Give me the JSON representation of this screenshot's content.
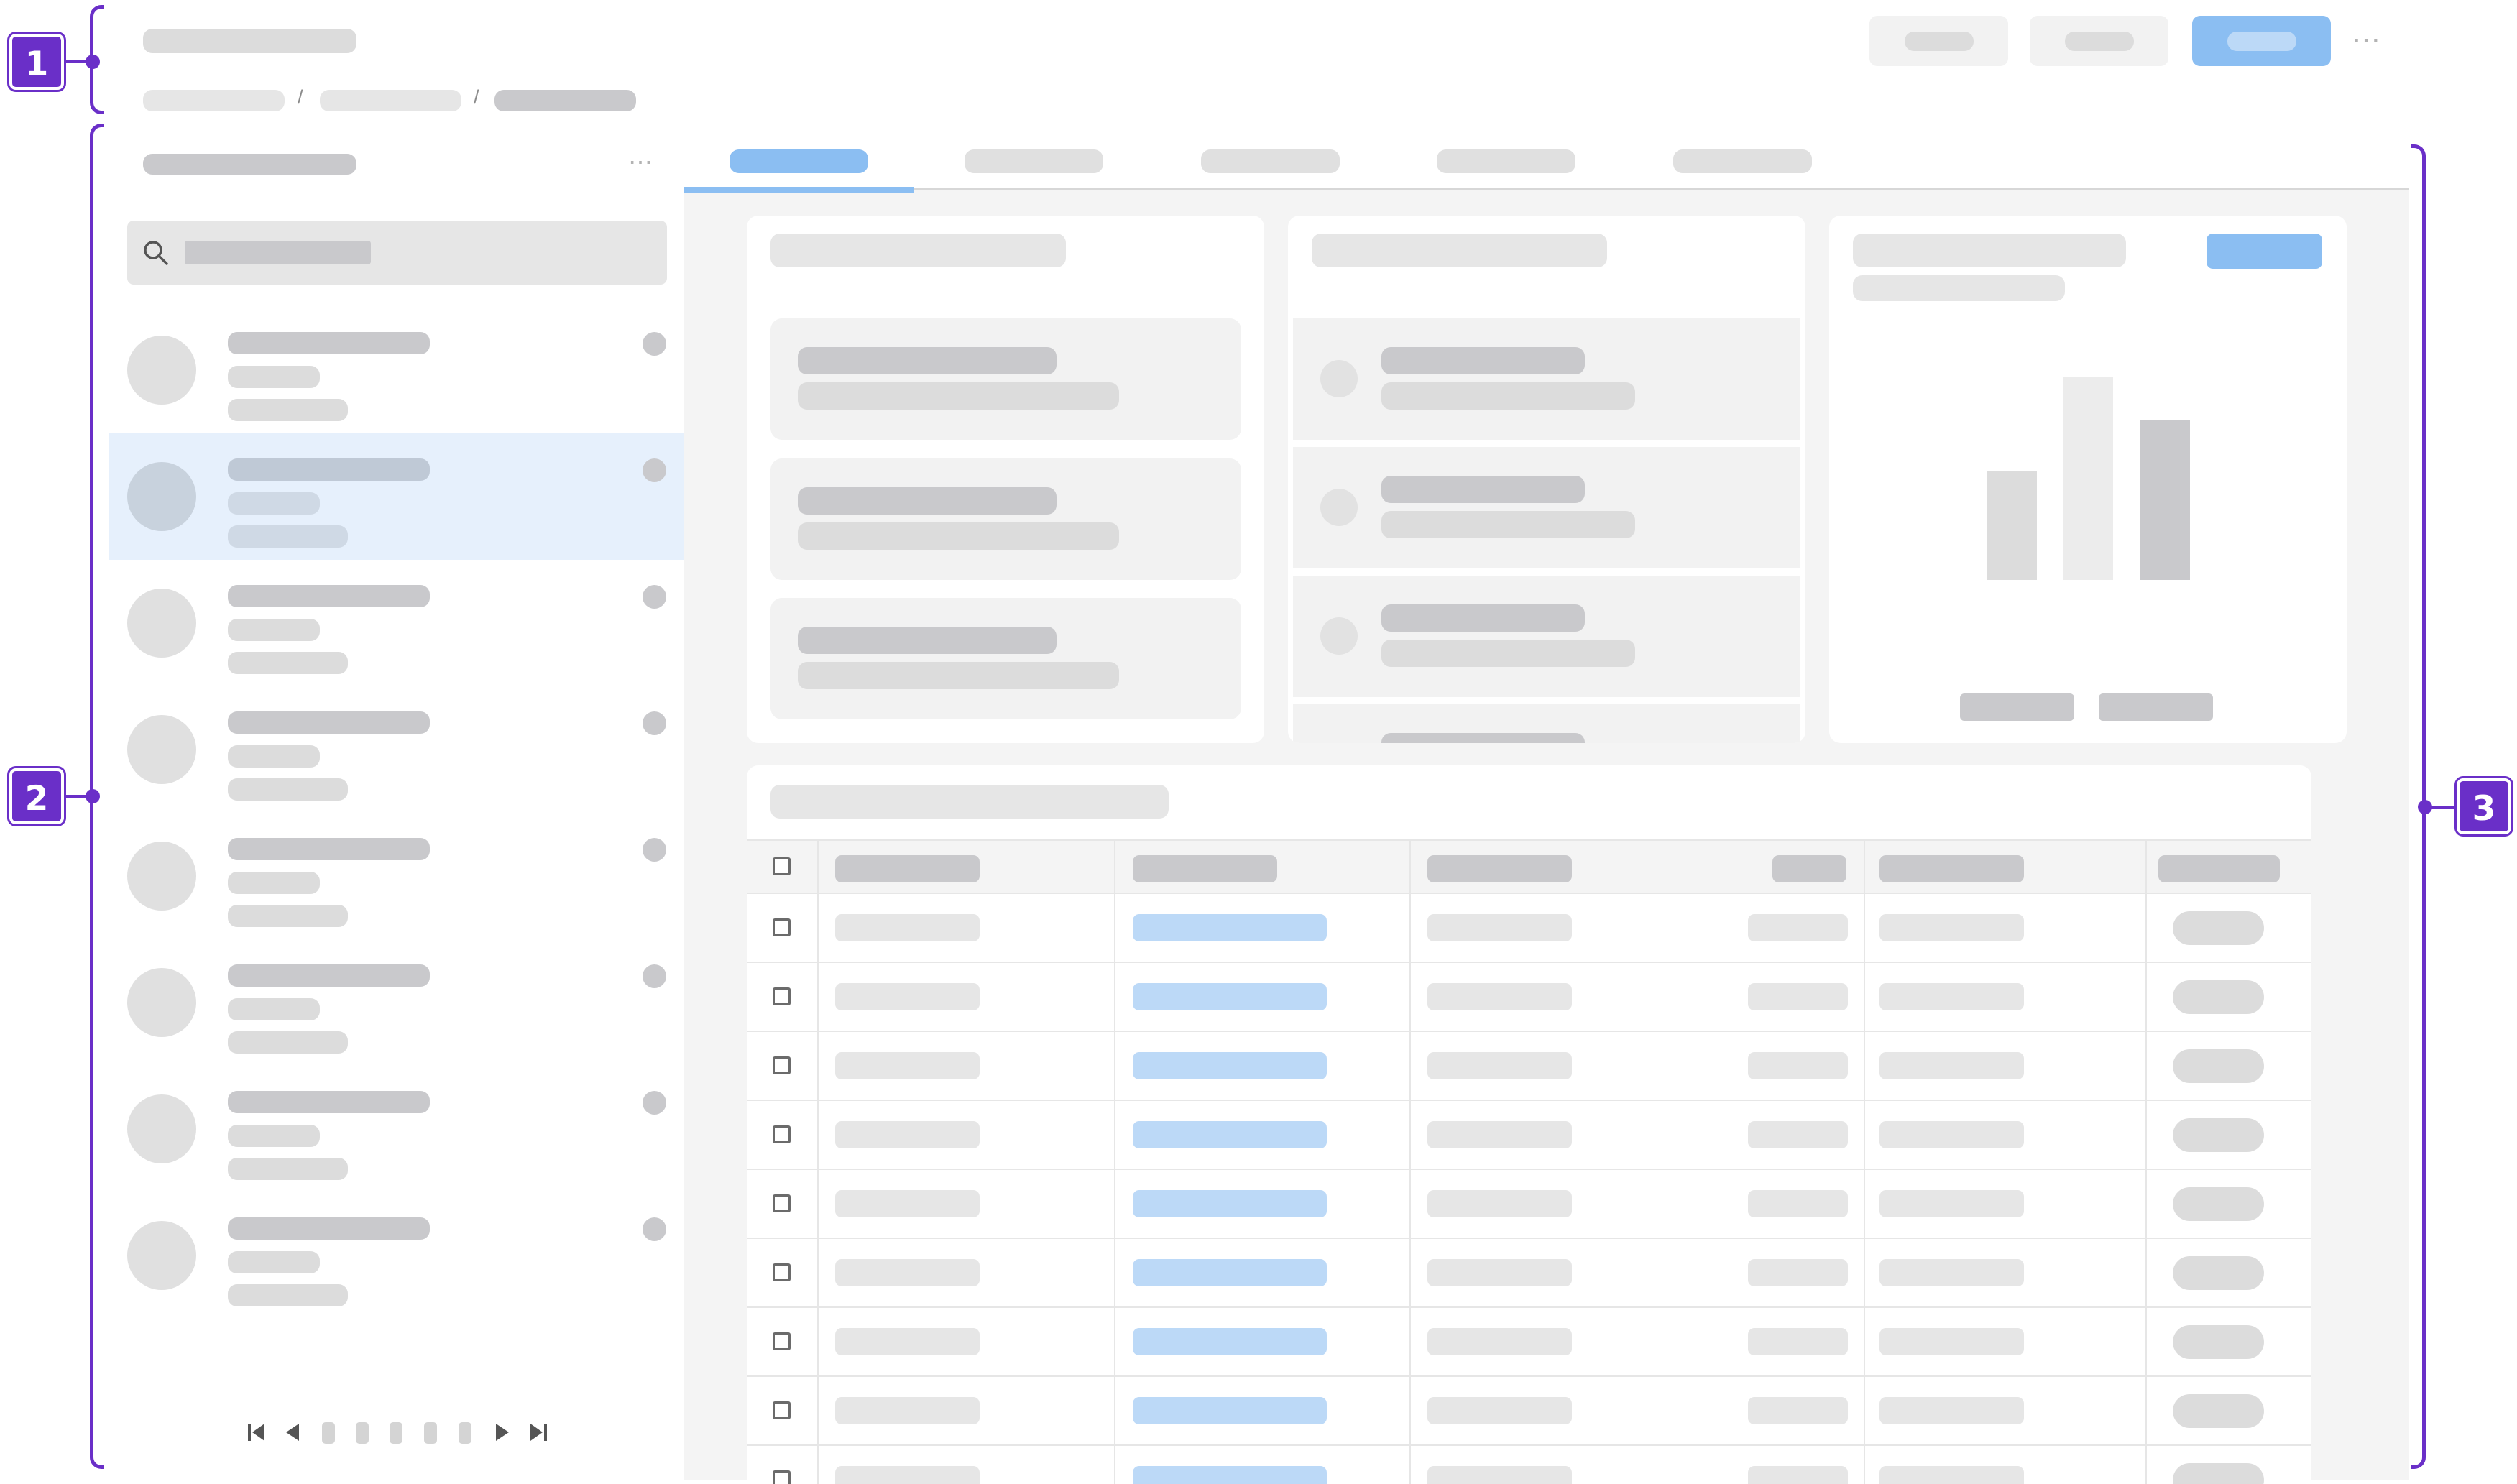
{
  "header": {
    "more_icon": "⋯",
    "breadcrumb_separators": [
      "/",
      "/"
    ]
  },
  "sidebar": {
    "more_icon": "⋯",
    "search_icon": "search-icon",
    "selected_index": 1,
    "item_count": 8
  },
  "main": {
    "active_tab": 0,
    "tab_count": 5,
    "table_row_count": 8
  },
  "annotations": {
    "badges": [
      "1",
      "2",
      "3"
    ]
  },
  "colors": {
    "accent": "#8bbef2",
    "accent_light": "#bcd9f7",
    "selection": "#e6f0fc",
    "annotation": "#6a2fc8"
  }
}
